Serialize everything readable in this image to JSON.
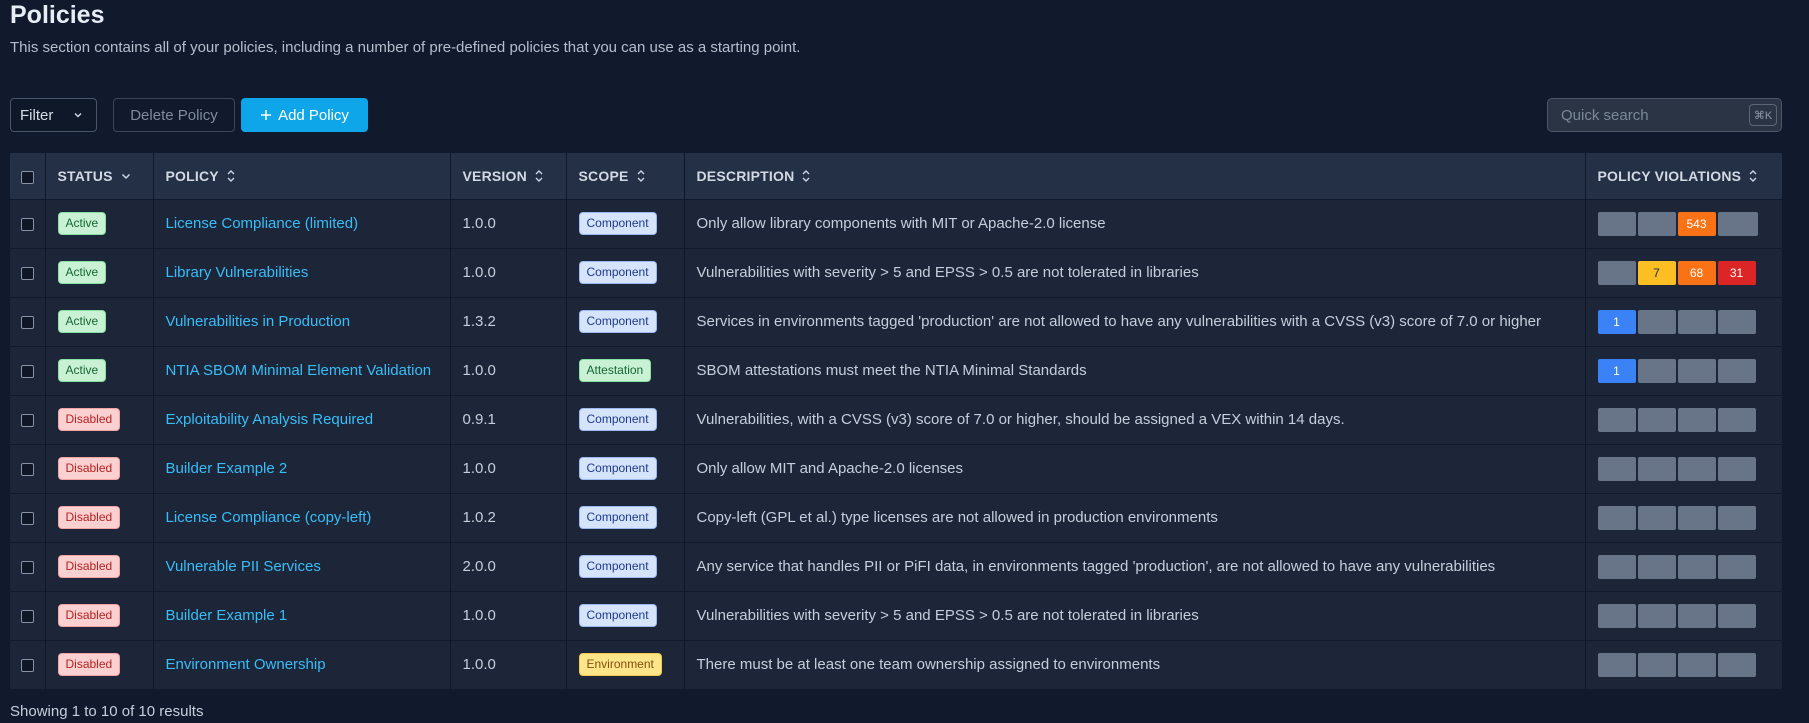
{
  "header": {
    "title": "Policies",
    "subtitle": "This section contains all of your policies, including a number of pre-defined policies that you can use as a starting point."
  },
  "toolbar": {
    "filter_label": "Filter",
    "delete_label": "Delete Policy",
    "add_label": "Add Policy",
    "search_placeholder": "Quick search",
    "search_shortcut": "⌘K"
  },
  "table": {
    "columns": {
      "status": "STATUS",
      "policy": "POLICY",
      "version": "VERSION",
      "scope": "SCOPE",
      "description": "DESCRIPTION",
      "violations": "POLICY VIOLATIONS"
    },
    "rows": [
      {
        "status": "Active",
        "policy": "License Compliance (limited)",
        "version": "1.0.0",
        "scope": "Component",
        "description": "Only allow library components with MIT or Apache-2.0 license",
        "violations": [
          {
            "v": "",
            "c": "gray"
          },
          {
            "v": "",
            "c": "gray"
          },
          {
            "v": "543",
            "c": "orange"
          },
          {
            "v": "",
            "c": "gray"
          }
        ]
      },
      {
        "status": "Active",
        "policy": "Library Vulnerabilities",
        "version": "1.0.0",
        "scope": "Component",
        "description": "Vulnerabilities with severity > 5 and EPSS > 0.5 are not tolerated in libraries",
        "violations": [
          {
            "v": "",
            "c": "gray"
          },
          {
            "v": "7",
            "c": "yellow"
          },
          {
            "v": "68",
            "c": "orange"
          },
          {
            "v": "31",
            "c": "red"
          }
        ]
      },
      {
        "status": "Active",
        "policy": "Vulnerabilities in Production",
        "version": "1.3.2",
        "scope": "Component",
        "description": "Services in environments tagged 'production' are not allowed to have any vulnerabilities with a CVSS (v3) score of 7.0 or higher",
        "violations": [
          {
            "v": "1",
            "c": "blue"
          },
          {
            "v": "",
            "c": "gray"
          },
          {
            "v": "",
            "c": "gray"
          },
          {
            "v": "",
            "c": "gray"
          }
        ]
      },
      {
        "status": "Active",
        "policy": "NTIA SBOM Minimal Element Validation",
        "version": "1.0.0",
        "scope": "Attestation",
        "description": "SBOM attestations must meet the NTIA Minimal Standards",
        "violations": [
          {
            "v": "1",
            "c": "blue"
          },
          {
            "v": "",
            "c": "gray"
          },
          {
            "v": "",
            "c": "gray"
          },
          {
            "v": "",
            "c": "gray"
          }
        ]
      },
      {
        "status": "Disabled",
        "policy": "Exploitability Analysis Required",
        "version": "0.9.1",
        "scope": "Component",
        "description": "Vulnerabilities, with a CVSS (v3) score of 7.0 or higher, should be assigned a VEX within 14 days.",
        "violations": [
          {
            "v": "",
            "c": "gray"
          },
          {
            "v": "",
            "c": "gray"
          },
          {
            "v": "",
            "c": "gray"
          },
          {
            "v": "",
            "c": "gray"
          }
        ]
      },
      {
        "status": "Disabled",
        "policy": "Builder Example 2",
        "version": "1.0.0",
        "scope": "Component",
        "description": "Only allow MIT and Apache-2.0 licenses",
        "violations": [
          {
            "v": "",
            "c": "gray"
          },
          {
            "v": "",
            "c": "gray"
          },
          {
            "v": "",
            "c": "gray"
          },
          {
            "v": "",
            "c": "gray"
          }
        ]
      },
      {
        "status": "Disabled",
        "policy": "License Compliance (copy-left)",
        "version": "1.0.2",
        "scope": "Component",
        "description": "Copy-left (GPL et al.) type licenses are not allowed in production environments",
        "violations": [
          {
            "v": "",
            "c": "gray"
          },
          {
            "v": "",
            "c": "gray"
          },
          {
            "v": "",
            "c": "gray"
          },
          {
            "v": "",
            "c": "gray"
          }
        ]
      },
      {
        "status": "Disabled",
        "policy": "Vulnerable PII Services",
        "version": "2.0.0",
        "scope": "Component",
        "description": "Any service that handles PII or PiFI data, in environments tagged 'production', are not allowed to have any vulnerabilities",
        "violations": [
          {
            "v": "",
            "c": "gray"
          },
          {
            "v": "",
            "c": "gray"
          },
          {
            "v": "",
            "c": "gray"
          },
          {
            "v": "",
            "c": "gray"
          }
        ]
      },
      {
        "status": "Disabled",
        "policy": "Builder Example 1",
        "version": "1.0.0",
        "scope": "Component",
        "description": "Vulnerabilities with severity > 5 and EPSS > 0.5 are not tolerated in libraries",
        "violations": [
          {
            "v": "",
            "c": "gray"
          },
          {
            "v": "",
            "c": "gray"
          },
          {
            "v": "",
            "c": "gray"
          },
          {
            "v": "",
            "c": "gray"
          }
        ]
      },
      {
        "status": "Disabled",
        "policy": "Environment Ownership",
        "version": "1.0.0",
        "scope": "Environment",
        "description": "There must be at least one team ownership assigned to environments",
        "violations": [
          {
            "v": "",
            "c": "gray"
          },
          {
            "v": "",
            "c": "gray"
          },
          {
            "v": "",
            "c": "gray"
          },
          {
            "v": "",
            "c": "gray"
          }
        ]
      }
    ]
  },
  "footer": {
    "results_text": "Showing 1 to 10 of 10 results"
  }
}
